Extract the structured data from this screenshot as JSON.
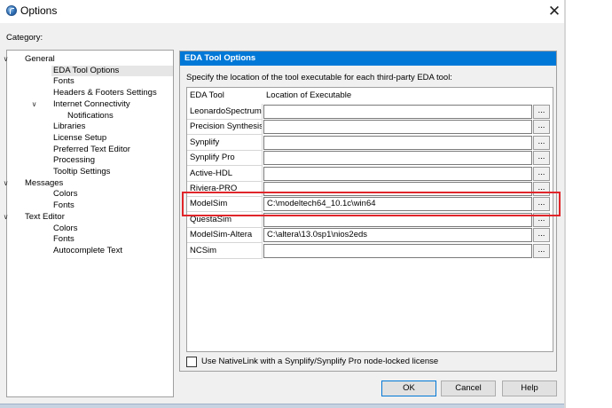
{
  "window": {
    "title": "Options",
    "close_glyph": "✕"
  },
  "category_label": "Category:",
  "tree": [
    {
      "label": "General",
      "expanded": true,
      "level": 0,
      "selected": false
    },
    {
      "label": "EDA Tool Options",
      "level": 1,
      "selected": true
    },
    {
      "label": "Fonts",
      "level": 1,
      "selected": false
    },
    {
      "label": "Headers & Footers Settings",
      "level": 1,
      "selected": false
    },
    {
      "label": "Internet Connectivity",
      "expanded": true,
      "level": 1,
      "selected": false
    },
    {
      "label": "Notifications",
      "level": 2,
      "selected": false
    },
    {
      "label": "Libraries",
      "level": 1,
      "selected": false
    },
    {
      "label": "License Setup",
      "level": 1,
      "selected": false
    },
    {
      "label": "Preferred Text Editor",
      "level": 1,
      "selected": false
    },
    {
      "label": "Processing",
      "level": 1,
      "selected": false
    },
    {
      "label": "Tooltip Settings",
      "level": 1,
      "selected": false
    },
    {
      "label": "Messages",
      "expanded": true,
      "level": 0,
      "selected": false
    },
    {
      "label": "Colors",
      "level": 1,
      "selected": false
    },
    {
      "label": "Fonts",
      "level": 1,
      "selected": false
    },
    {
      "label": "Text Editor",
      "expanded": true,
      "level": 0,
      "selected": false
    },
    {
      "label": "Colors",
      "level": 1,
      "selected": false
    },
    {
      "label": "Fonts",
      "level": 1,
      "selected": false
    },
    {
      "label": "Autocomplete Text",
      "level": 1,
      "selected": false
    }
  ],
  "panel": {
    "header": "EDA Tool Options",
    "description": "Specify the location of the tool executable for each third-party EDA tool:",
    "columns": [
      "EDA Tool",
      "Location of Executable"
    ],
    "browse_label": "...",
    "rows": [
      {
        "tool": "LeonardoSpectrum",
        "path": ""
      },
      {
        "tool": "Precision Synthesis",
        "path": ""
      },
      {
        "tool": "Synplify",
        "path": ""
      },
      {
        "tool": "Synplify Pro",
        "path": ""
      },
      {
        "tool": "Active-HDL",
        "path": ""
      },
      {
        "tool": "Riviera-PRO",
        "path": ""
      },
      {
        "tool": "ModelSim",
        "path": "C:\\modeltech64_10.1c\\win64"
      },
      {
        "tool": "QuestaSim",
        "path": ""
      },
      {
        "tool": "ModelSim-Altera",
        "path": "C:\\altera\\13.0sp1\\nios2eds"
      },
      {
        "tool": "NCSim",
        "path": ""
      }
    ],
    "nativelink_label": "Use NativeLink with a Synplify/Synplify Pro node-locked license",
    "nativelink_checked": false
  },
  "buttons": {
    "ok": "OK",
    "cancel": "Cancel",
    "help": "Help"
  },
  "colors": {
    "accent": "#0078d7",
    "highlight_box": "#e0262b"
  }
}
